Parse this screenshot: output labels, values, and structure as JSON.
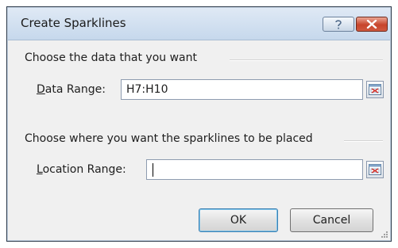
{
  "dialog": {
    "title": "Create Sparklines",
    "help_icon": "question-mark-icon",
    "close_icon": "close-icon"
  },
  "data_section": {
    "header": "Choose the data that you want",
    "label_accel": "D",
    "label_rest": "ata Range:",
    "value": "H7:H10"
  },
  "location_section": {
    "header": "Choose where you want the sparklines to be placed",
    "label_accel": "L",
    "label_rest": "ocation Range:",
    "value": ""
  },
  "buttons": {
    "ok": "OK",
    "cancel": "Cancel"
  },
  "icons": {
    "collapse": "range-select-icon",
    "grip": "resize-grip-icon"
  },
  "colors": {
    "titlebar": "#c6d8ec",
    "close": "#c7442a",
    "dialog_bg": "#f0f0f0"
  }
}
